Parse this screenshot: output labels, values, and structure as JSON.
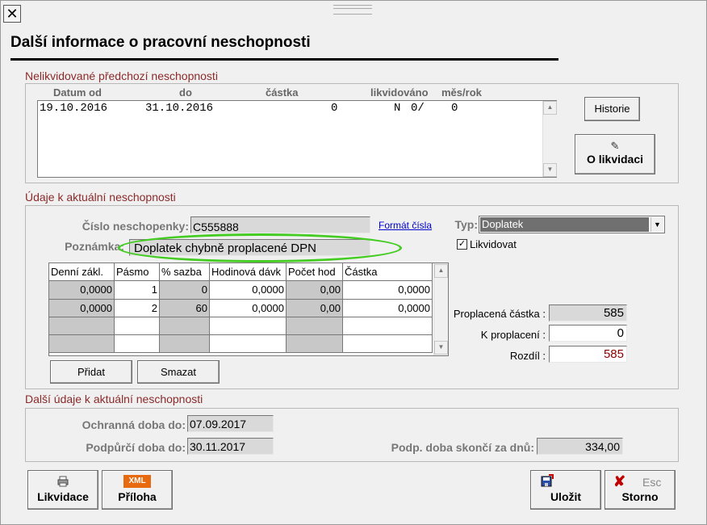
{
  "window": {
    "close_glyph": "✕",
    "title": "Další informace o pracovní neschopnosti"
  },
  "prev": {
    "section_title": "Nelikvidované předchozí neschopnosti",
    "columns": [
      "Datum od",
      "do",
      "částka",
      "likvidováno",
      "měs/rok"
    ],
    "rows": [
      {
        "from": "19.10.2016",
        "to": "31.10.2016",
        "amount": "0",
        "liquidated": "N",
        "month_year": "0/",
        "extra": "0"
      }
    ],
    "historie_label": "Historie",
    "olikvidaci_label": "O likvidaci",
    "olikvidaci_icon": "pencil-icon"
  },
  "current": {
    "section_title": "Údaje k aktuální neschopnosti",
    "cislo_label": "Číslo neschopenky:",
    "cislo_value": "C555888",
    "format_link": "Formát čísla",
    "typ_label": "Typ:",
    "typ_value": "Doplatek",
    "poznamka_label": "Poznámka:",
    "poznamka_value": "Doplatek chybně proplacené DPN",
    "likvidovat_label": "Likvidovat",
    "likvidovat_checked": true,
    "grid": {
      "headers": [
        "Denní zákl.",
        "Pásmo",
        "% sazba",
        "Hodinová dávk",
        "Počet hod",
        "Částka"
      ],
      "rows": [
        [
          "0,0000",
          "1",
          "0",
          "0,0000",
          "0,00",
          "0,0000"
        ],
        [
          "0,0000",
          "2",
          "60",
          "0,0000",
          "0,00",
          "0,0000"
        ],
        [
          "",
          "",
          "",
          "",
          "",
          ""
        ],
        [
          "",
          "",
          "",
          "",
          "",
          ""
        ]
      ]
    },
    "pridat_label": "Přidat",
    "smazat_label": "Smazat",
    "proplacena_label": "Proplacená částka :",
    "proplacena_value": "585",
    "kproplaceni_label": "K proplacení :",
    "kproplaceni_value": "0",
    "rozdil_label": "Rozdíl :",
    "rozdil_value": "585",
    "rozdil_color": "#8b0000",
    "highlight_color": "#44cc22"
  },
  "further": {
    "section_title": "Další údaje k aktuální neschopnosti",
    "ochranna_label": "Ochranná doba do:",
    "ochranna_value": "07.09.2017",
    "podpurci_label": "Podpůrčí doba do:",
    "podpurci_value": "30.11.2017",
    "skonci_label": "Podp. doba skončí za dnů:",
    "skonci_value": "334,00"
  },
  "footer": {
    "likvidace_label": "Likvidace",
    "likvidace_icon": "printer-icon",
    "priloha_label": "Příloha",
    "priloha_badge": "XML",
    "ulozit_label": "Uložit",
    "ulozit_icon": "save-icon",
    "storno_label": "Storno",
    "storno_hint": "Esc",
    "storno_icon": "cross-icon"
  }
}
